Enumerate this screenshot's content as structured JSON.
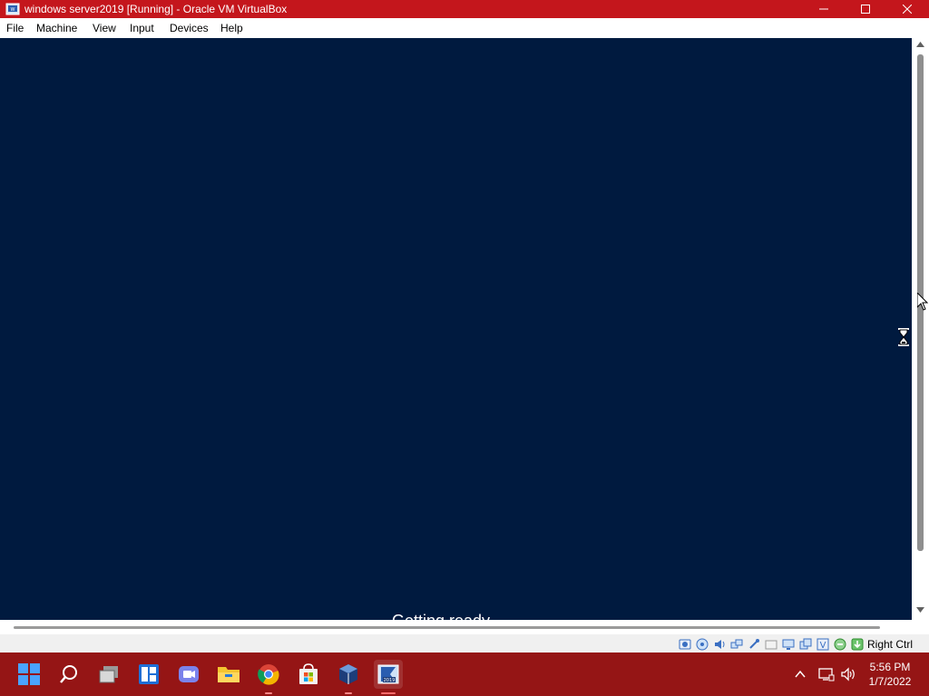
{
  "window": {
    "title": "windows server2019 [Running] - Oracle VM VirtualBox"
  },
  "menu": {
    "items": [
      "File",
      "Machine",
      "View",
      "Input",
      "Devices",
      "Help"
    ]
  },
  "vm": {
    "status_text": "Getting ready..."
  },
  "statusbar": {
    "icons": [
      "hard-disk-icon",
      "optical-drive-icon",
      "audio-icon",
      "network-icon",
      "usb-icon",
      "shared-folders-icon",
      "display-icon",
      "video-capture-icon",
      "virtualization-icon",
      "mouse-integration-icon",
      "keyboard-capture-icon"
    ],
    "host_key": "Right Ctrl"
  },
  "taskbar": {
    "apps": [
      "start-icon",
      "search-icon",
      "task-view-icon",
      "widgets-icon",
      "teams-chat-icon",
      "file-explorer-icon",
      "chrome-icon",
      "microsoft-store-icon",
      "virtualbox-icon",
      "vm-window-icon"
    ],
    "time": "5:56 PM",
    "date": "1/7/2022"
  },
  "colors": {
    "titlebar": "#c4161c",
    "vm_background": "#001a3f",
    "taskbar": "#951515"
  }
}
